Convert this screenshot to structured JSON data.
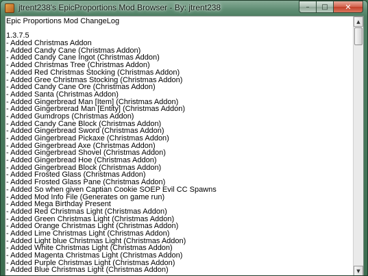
{
  "window": {
    "title": "jtrent238's EpicProportions Mod Browser - By: jtrent238",
    "controls": {
      "minimize": "–",
      "maximize": "□",
      "close": "✕"
    }
  },
  "changelog": {
    "lines": [
      "Epic Proportions Mod ChangeLog",
      "",
      "1.3.7.5",
      "- Added Christmas Addon",
      "- Added Candy Cane (Christmas Addon)",
      "- Added Candy Cane Ingot (Christmas Addon)",
      "- Added Christmas Tree (Christmas Addon)",
      "- Added Red Christmas Stocking (Christmas Addon)",
      "- Added Gree Christmas Stocking (Christmas Addon)",
      "- Added Candy Cane Ore (Christmas Addon)",
      "- Added Santa (Christmas Addon)",
      "- Added Gingerbread Man [Item] (Christmas Addon)",
      "- Added Gingerbrerad Man [Entity] (Christmas Addon)",
      "- Added Gumdrops (Christmas Addon)",
      "- Added Candy Cane Block (Christmas Addon)",
      "- Added Gingerbread Sword (Christmas Addon)",
      "- Added Gingerbread Pickaxe (Christmas Addon)",
      "- Added Gingerbread Axe (Christmas Addon)",
      "- Added Gingerbread Shovel (Christmas Addon)",
      "- Added Gingerbread Hoe (Christmas Addon)",
      "- Added Gingerbread Block (Christmas Addon)",
      "- Added Frosted Glass (Christmas Addon)",
      "- Added Frosted Glass Pane (Christmas Addon)",
      "- Added So when given Captian Cookie SOEP Evil CC Spawns",
      "- Added Mod Info File (Generates on game run)",
      "- Added Mega Birthday Present",
      "- Added Red Christmas Light (Christmas Addon)",
      "- Added Green Christmas Light (Christmas Addon)",
      "- Added Orange Christmas Light (Christmas Addon)",
      "- Added Lime Christmas Light (Christmas Addon)",
      "- Added Light blue Christmas Light (Christmas Addon)",
      "- Added White Christmas Light (Christmas Addon)",
      "- Added Magenta Christmas Light (Christmas Addon)",
      "- Added Purple Christmas Light (Christmas Addon)",
      "- Added Blue Christmas Light (Christmas Addon)"
    ]
  },
  "scrollbar": {
    "position_fraction": 0.0,
    "up_arrow": "▲",
    "down_arrow": "▼"
  }
}
